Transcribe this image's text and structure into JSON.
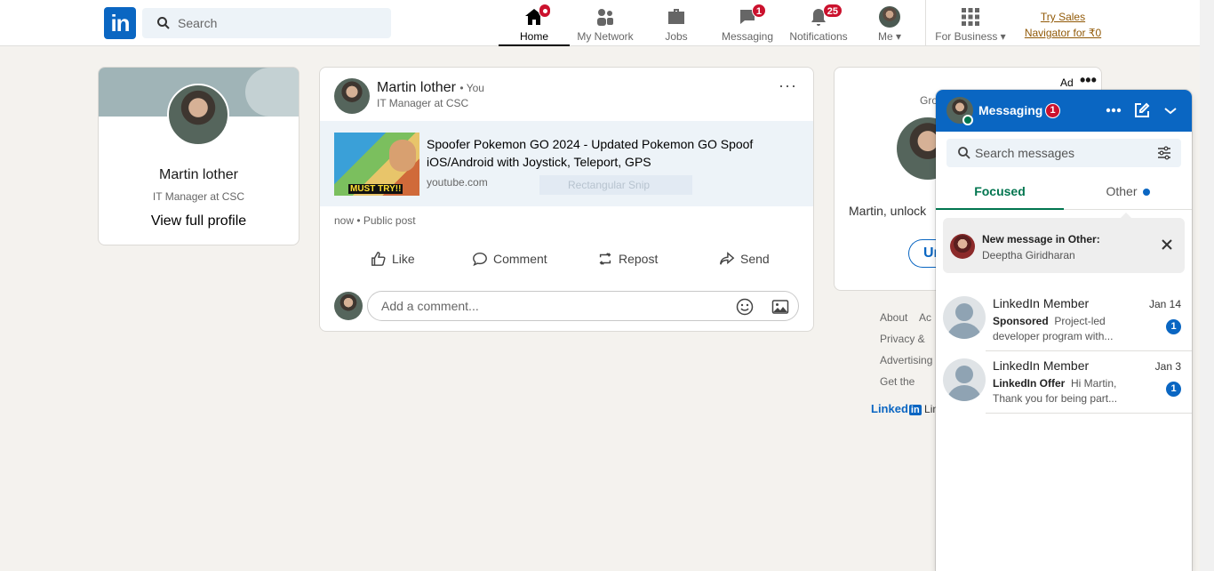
{
  "nav": {
    "search_placeholder": "Search",
    "items": [
      {
        "label": "Home",
        "badge": ""
      },
      {
        "label": "My Network",
        "badge": ""
      },
      {
        "label": "Jobs",
        "badge": ""
      },
      {
        "label": "Messaging",
        "badge": "1"
      },
      {
        "label": "Notifications",
        "badge": "25"
      },
      {
        "label": "Me",
        "badge": ""
      },
      {
        "label": "For Business",
        "badge": ""
      }
    ],
    "try_sales": "Try Sales Navigator for ₹0"
  },
  "profile": {
    "name": "Martin lother",
    "title": "IT Manager at CSC",
    "link": "View full profile"
  },
  "post": {
    "author": "Martin lother",
    "you_label": "• You",
    "subtitle": "IT Manager at CSC",
    "more": "···",
    "link_title": "Spoofer Pokemon GO 2024 - Updated Pokemon GO Spoof iOS/Android with Joystick, Teleport, GPS",
    "link_domain": "youtube.com",
    "thumb_text": "MUST TRY!!",
    "snip_overlay": "Rectangular Snip",
    "meta": "now • Public post",
    "actions": {
      "like": "Like",
      "comment": "Comment",
      "repost": "Repost",
      "send": "Send"
    },
    "comment_placeholder": "Add a comment..."
  },
  "ad": {
    "label": "Ad",
    "dots": "•••",
    "gro_text": "Gro",
    "unlock_text": "Martin, unlock",
    "button_text": "Ur"
  },
  "footer": {
    "links": [
      "About    Ac",
      "Privacy &",
      "Advertising",
      "Get the"
    ],
    "brand": "Linked",
    "brand_in": "in",
    "brand_tail": " Lin"
  },
  "messaging": {
    "title": "Messaging",
    "badge": "1",
    "search_placeholder": "Search messages",
    "tabs": {
      "focused": "Focused",
      "other": "Other"
    },
    "notice": {
      "title": "New message in Other:",
      "sender": "Deeptha Giridharan"
    },
    "conversations": [
      {
        "name": "LinkedIn Member",
        "date": "Jan 14",
        "tag": "Sponsored",
        "preview": "Project-led developer program with...",
        "unread": "1"
      },
      {
        "name": "LinkedIn Member",
        "date": "Jan 3",
        "tag": "LinkedIn Offer",
        "preview": "Hi Martin, Thank you for being part...",
        "unread": "1"
      }
    ]
  },
  "colors": {
    "brand_blue": "#0a66c2",
    "badge_red": "#cb112d",
    "focused_green": "#01754f",
    "page_bg": "#f4f2ee"
  }
}
